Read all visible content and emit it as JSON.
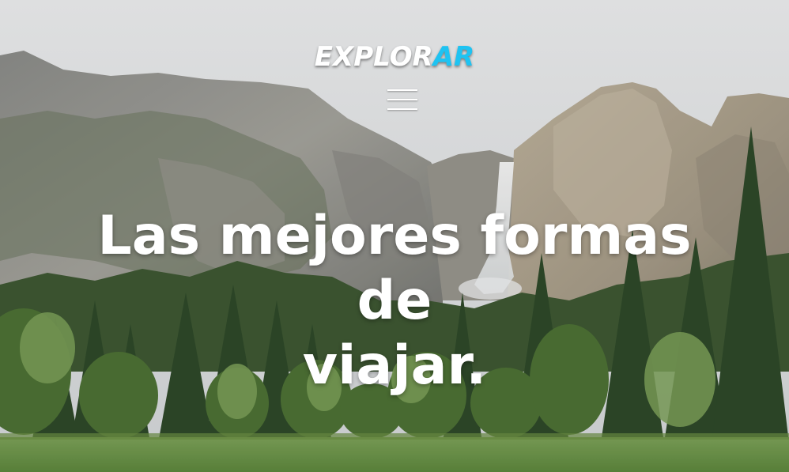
{
  "header": {
    "logo_main": "EXPLOR",
    "logo_accent": "AR",
    "menu_icon": "hamburger-menu-icon"
  },
  "hero": {
    "background": "yosemite-valley-waterfall-photo",
    "headline_lines": [
      "Las mejores formas",
      "de",
      "viajar."
    ]
  },
  "colors": {
    "accent": "#1ec3f2",
    "text": "#ffffff"
  }
}
